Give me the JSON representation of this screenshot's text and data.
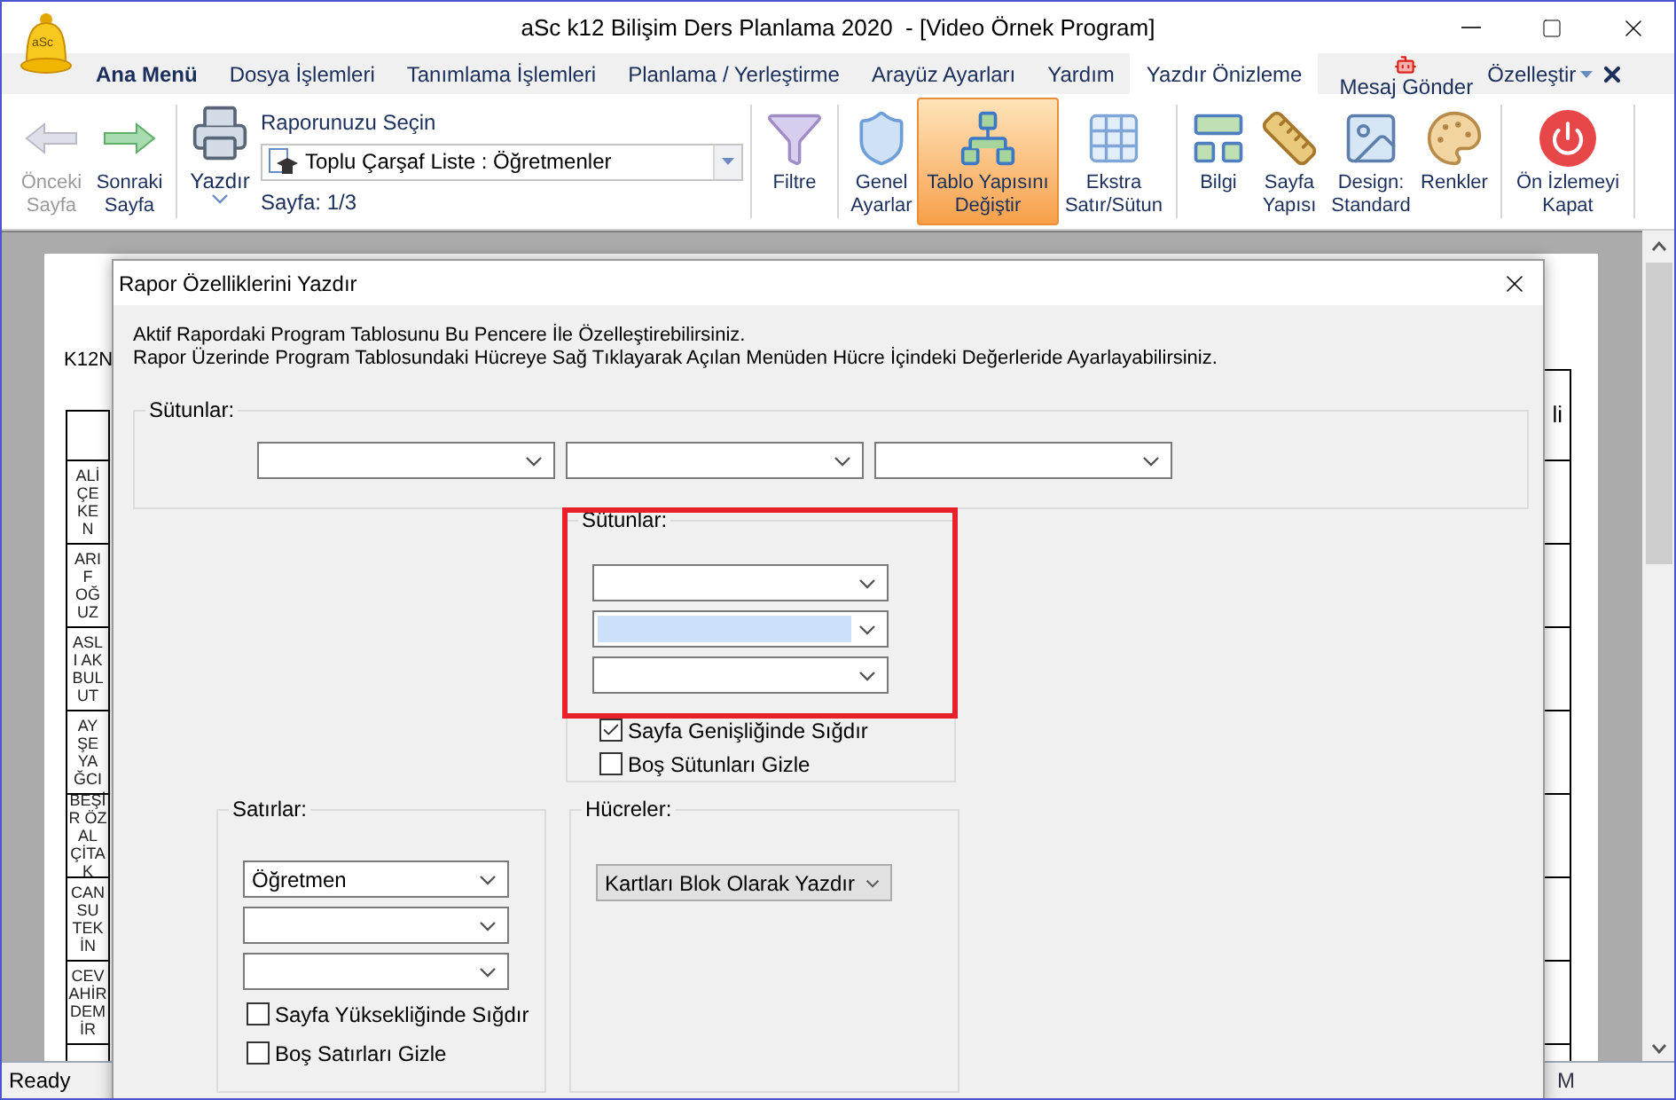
{
  "window": {
    "title": "aSc k12 Bilişim Ders Planlama 2020  - [Video Örnek Program]",
    "logo_text": "aSc"
  },
  "menu_tabs": [
    {
      "label": "Ana Menü",
      "selected": false,
      "bold": true
    },
    {
      "label": "Dosya İşlemleri",
      "selected": false,
      "bold": false
    },
    {
      "label": "Tanımlama İşlemleri",
      "selected": false,
      "bold": false
    },
    {
      "label": "Planlama / Yerleştirme",
      "selected": false,
      "bold": false
    },
    {
      "label": "Arayüz Ayarları",
      "selected": false,
      "bold": false
    },
    {
      "label": "Yardım",
      "selected": false,
      "bold": false
    },
    {
      "label": "Yazdır Önizleme",
      "selected": true,
      "bold": false
    }
  ],
  "message_button": {
    "label": "Mesaj Gönder"
  },
  "customize_menu": {
    "label": "Özelleştir"
  },
  "ribbon": {
    "nav": [
      {
        "label": "Önceki\nSayfa",
        "disabled": true
      },
      {
        "label": "Sonraki\nSayfa",
        "disabled": false
      }
    ],
    "print": {
      "label": "Yazdır"
    },
    "report": {
      "label": "Raporunuzu Seçin",
      "value": "Toplu Çarşaf Liste : Öğretmenler",
      "page": "Sayfa: 1/3"
    },
    "filter": {
      "label": "Filtre"
    },
    "tools": [
      {
        "label": "Genel\nAyarlar",
        "selected": false
      },
      {
        "label": "Tablo Yapısını\nDeğiştir",
        "selected": true
      },
      {
        "label": "Ekstra\nSatır/Sütun",
        "selected": false
      }
    ],
    "view": [
      {
        "label": "Bilgi"
      },
      {
        "label": "Sayfa\nYapısı"
      },
      {
        "label": "Design:\nStandard"
      },
      {
        "label": "Renkler"
      }
    ],
    "close": {
      "label": "Ön İzlemeyi\nKapat"
    }
  },
  "preview": {
    "heading_fragment": "K12N",
    "right_heading_fragment": "li",
    "teachers": [
      {
        "name": "ALİ\nÇE\nKE\nN"
      },
      {
        "name": "ARI\nF\nOĞ\nUZ"
      },
      {
        "name": "ASL\nI AK\nBUL\nUT"
      },
      {
        "name": "AY\nŞE\nYA\nĞCI"
      },
      {
        "name": "BEŞİ\nR ÖZ\nAL\nÇİTA\nK"
      },
      {
        "name": "CAN\nSU\nTEK\nİN"
      },
      {
        "name": "CEV\nAHİR\nDEM\nİR"
      }
    ]
  },
  "dialog": {
    "title": "Rapor Özelliklerini Yazdır",
    "description": [
      "Aktif Rapordaki Program Tablosunu Bu Pencere İle Özelleştirebilirsiniz.",
      "Rapor Üzerinde Program Tablosundaki Hücreye Sağ Tıklayarak Açılan Menüden Hücre İçindeki Değerleride Ayarlayabilirsiniz."
    ],
    "columns_top": {
      "legend": "Sütunlar:",
      "dropdowns": [
        {
          "highlighted": false
        },
        {
          "highlighted": false
        },
        {
          "highlighted": false
        }
      ]
    },
    "columns": {
      "legend": "Sütunlar:",
      "dropdowns": [
        {
          "highlighted": false
        },
        {
          "highlighted": true
        },
        {
          "highlighted": false
        }
      ],
      "checkboxes": [
        {
          "label": "Sayfa Genişliğinde Sığdır",
          "checked": true
        },
        {
          "label": "Boş Sütunları Gizle",
          "checked": false
        }
      ]
    },
    "rows": {
      "legend": "Satırlar:",
      "dropdowns": [
        {
          "value": "Öğretmen",
          "highlighted": false
        },
        {
          "highlighted": false
        },
        {
          "highlighted": false
        }
      ],
      "checkboxes": [
        {
          "label": "Sayfa Yüksekliğinde Sığdır",
          "checked": false
        },
        {
          "label": "Boş Satırları Gizle",
          "checked": false
        }
      ]
    },
    "cells": {
      "legend": "Hücreler:",
      "dropdown": {
        "value": "Kartları Blok Olarak Yazdır",
        "disabled": true
      }
    }
  },
  "status_bar": {
    "text": "Ready",
    "right_fragment": "M"
  }
}
